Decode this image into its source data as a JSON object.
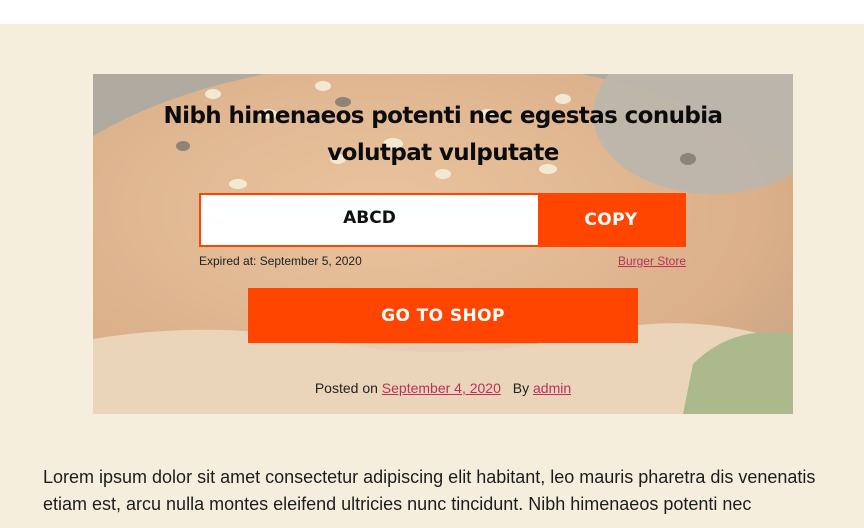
{
  "hero": {
    "title": "Nibh himenaeos potenti nec egestas conubia volutpat vulputate",
    "coupon_code": "ABCD",
    "copy_label": "COPY",
    "expiry": "Expired at: September 5, 2020",
    "store_link": "Burger Store",
    "shop_button": "GO TO SHOP",
    "background_image": "burger-photo"
  },
  "post_meta": {
    "posted_on_label": "Posted on",
    "date": "September 4, 2020",
    "by_label": "By",
    "author": "admin"
  },
  "body": {
    "paragraph": "Lorem ipsum dolor sit amet consectetur adipiscing elit habitant, leo mauris pharetra dis venenatis etiam est, arcu nulla montes eleifend ultricies nunc tincidunt. Nibh himenaeos potenti nec"
  },
  "colors": {
    "accent": "#ff4500",
    "link": "#b8325a",
    "background": "#f5eedd"
  }
}
